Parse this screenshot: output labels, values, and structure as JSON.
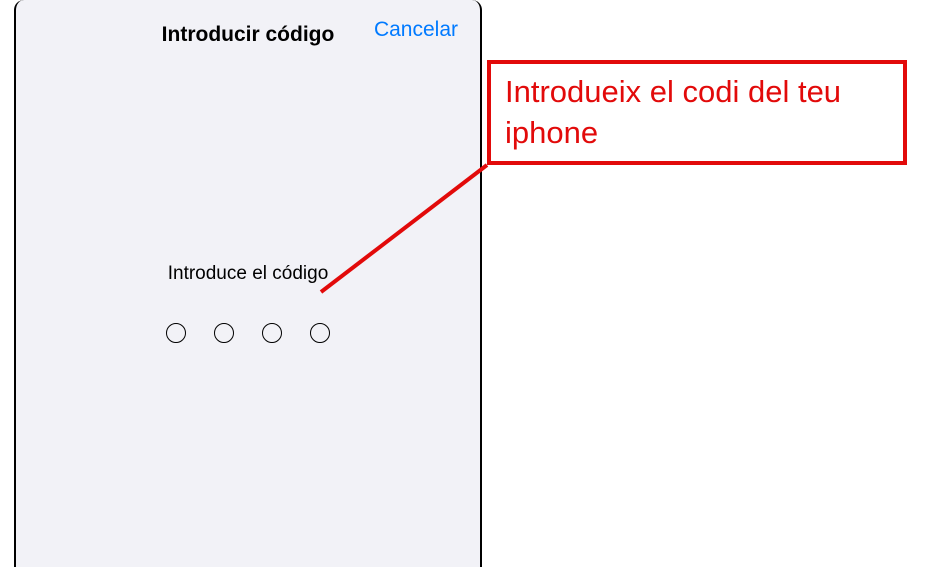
{
  "header": {
    "title": "Introducir código",
    "cancel_label": "Cancelar"
  },
  "content": {
    "prompt": "Introduce el código",
    "passcode_length": 4
  },
  "annotation": {
    "text": "Introdueix el codi del teu iphone",
    "color": "#e20a0a"
  }
}
